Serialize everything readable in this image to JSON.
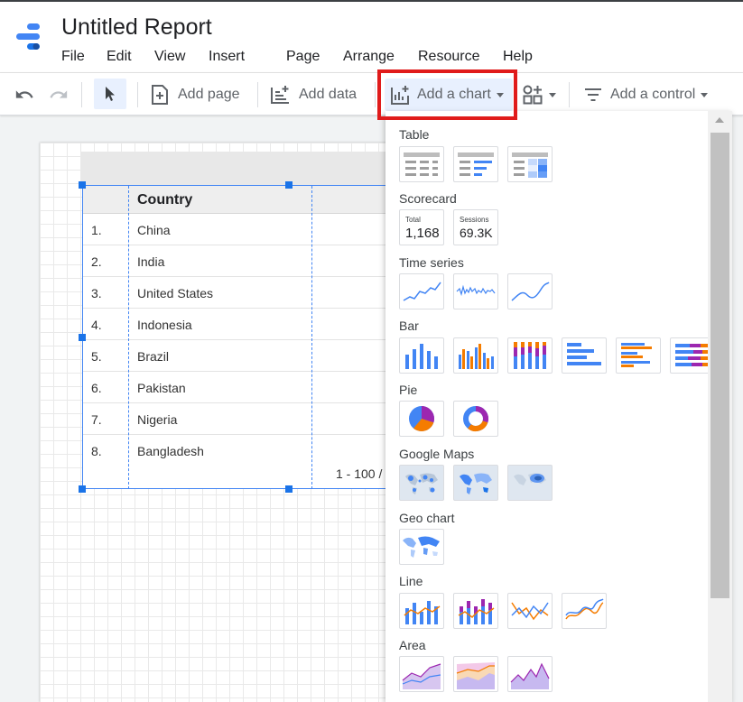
{
  "app": {
    "title": "Untitled Report",
    "menu": [
      "File",
      "Edit",
      "View",
      "Insert",
      "Page",
      "Arrange",
      "Resource",
      "Help"
    ]
  },
  "toolbar": {
    "add_page": "Add page",
    "add_data": "Add data",
    "add_chart": "Add a chart",
    "add_control": "Add a control"
  },
  "table": {
    "column_header": "Country",
    "rows": [
      {
        "num": "1.",
        "country": "China"
      },
      {
        "num": "2.",
        "country": "India"
      },
      {
        "num": "3.",
        "country": "United States"
      },
      {
        "num": "4.",
        "country": "Indonesia"
      },
      {
        "num": "5.",
        "country": "Brazil"
      },
      {
        "num": "6.",
        "country": "Pakistan"
      },
      {
        "num": "7.",
        "country": "Nigeria"
      },
      {
        "num": "8.",
        "country": "Bangladesh"
      }
    ],
    "pagination": "1 - 100 /"
  },
  "chart_menu": {
    "sections": {
      "table": "Table",
      "scorecard": "Scorecard",
      "time_series": "Time series",
      "bar": "Bar",
      "pie": "Pie",
      "google_maps": "Google Maps",
      "geo_chart": "Geo chart",
      "line": "Line",
      "area": "Area"
    },
    "scorecards": [
      {
        "label": "Total",
        "value": "1,168"
      },
      {
        "label": "Sessions",
        "value": "69.3K"
      }
    ]
  },
  "colors": {
    "accent": "#4285f4",
    "highlight": "#e01b1b",
    "orange": "#f57c00",
    "purple": "#9c27b0",
    "selected_bg": "#e8f0fe"
  }
}
